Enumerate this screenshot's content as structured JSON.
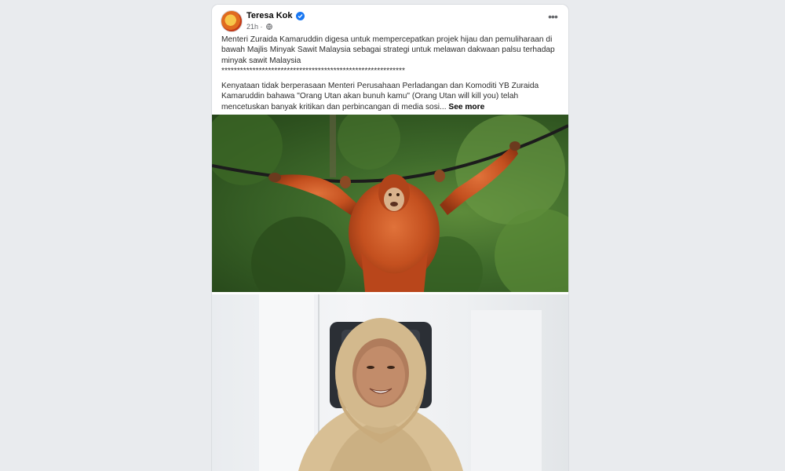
{
  "post": {
    "author": "Teresa Kok",
    "timestamp": "21h",
    "paragraph1": "Menteri Zuraida Kamaruddin digesa untuk mempercepatkan projek hijau dan pemuliharaan di bawah Majlis Minyak Sawit Malaysia sebagai strategi untuk melawan dakwaan palsu terhadap minyak sawit Malaysia",
    "divider": "***********************************************************",
    "paragraph2": "Kenyataan tidak berperasaan Menteri Perusahaan Perladangan dan Komoditi YB Zuraida Kamaruddin bahawa \"Orang Utan akan bunuh kamu\" (Orang Utan will kill you) telah mencetuskan banyak kritikan dan perbincangan di media sosi...",
    "see_more": "See more",
    "more_icon": "more-horizontal-icon",
    "verified_icon": "verified-badge-icon",
    "privacy_icon": "globe-icon"
  },
  "colors": {
    "background": "#e9ebee",
    "card": "#ffffff",
    "verified": "#1877f2",
    "meta_text": "#65676b"
  }
}
